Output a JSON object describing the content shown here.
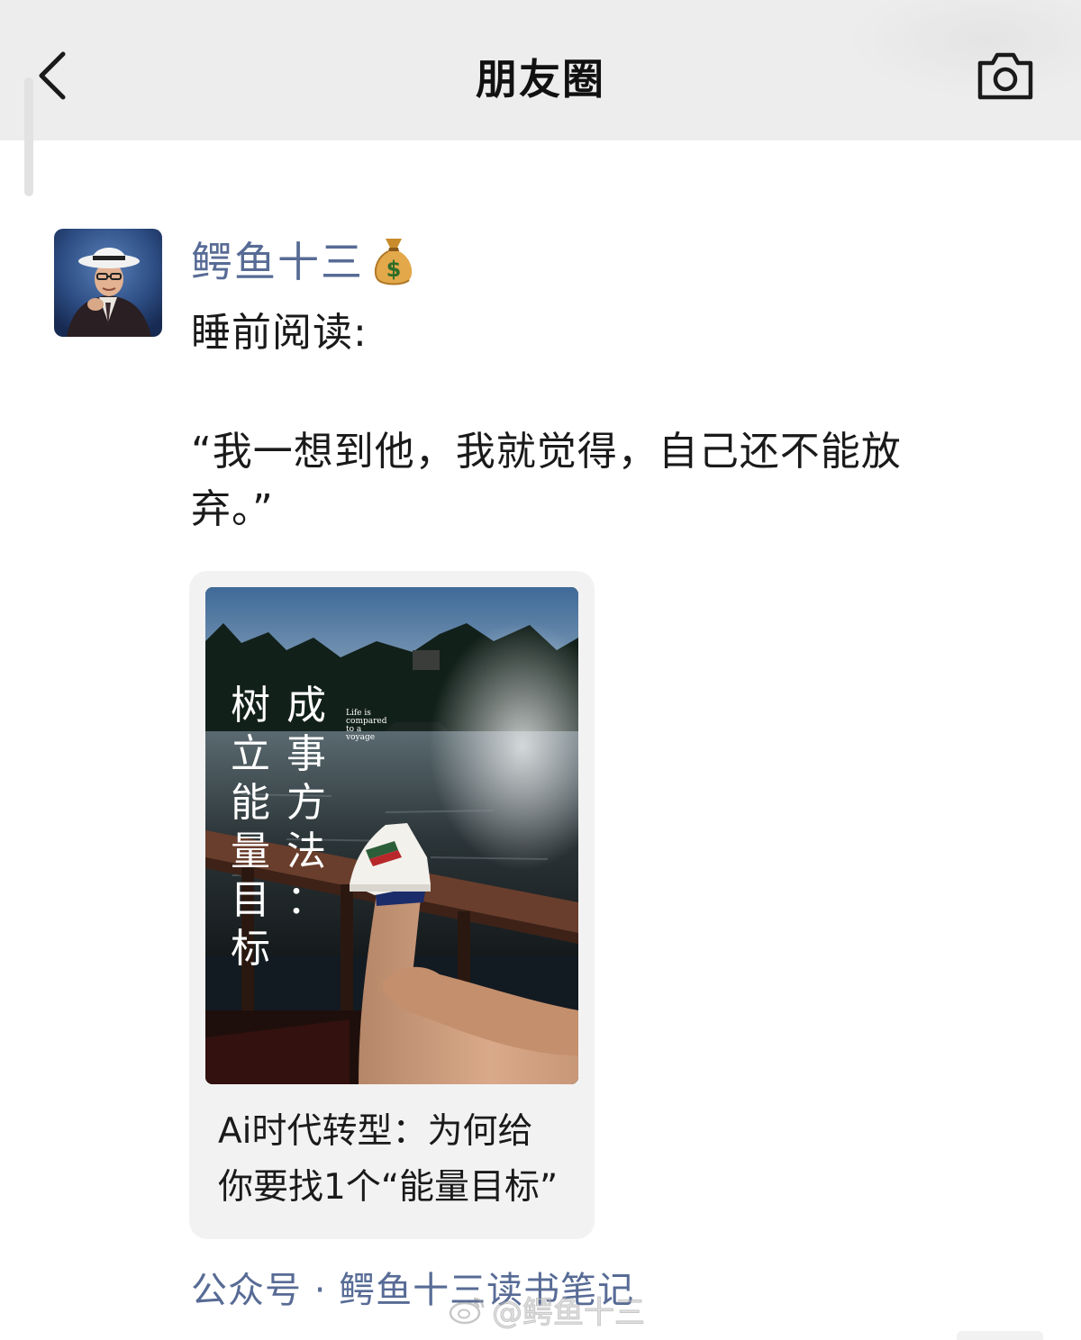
{
  "header": {
    "title": "朋友圈",
    "back_icon": "chevron-left-icon",
    "camera_icon": "camera-icon"
  },
  "post": {
    "author": "鳄鱼十三",
    "author_badge_icon": "money-bag-icon",
    "text_line1": "睡前阅读:",
    "text_line2": "“我一想到他，我就觉得，自己还不能放",
    "text_line3": "弃。”",
    "card": {
      "cover_title_right": [
        "成",
        "事",
        "方",
        "法",
        "："
      ],
      "cover_title_left": [
        "树",
        "立",
        "能",
        "量",
        "目",
        "标"
      ],
      "cover_small_lines": [
        "Life is",
        "compared",
        "to a",
        "voyage"
      ],
      "caption_line1": "Ai时代转型：为何给",
      "caption_line2": "你要找1个“能量目标”"
    },
    "source": "公众号 · 鳄鱼十三读书笔记"
  },
  "watermark": {
    "text": "@鳄鱼十三",
    "icon": "weibo-logo-icon"
  },
  "colors": {
    "header_bg": "#ededed",
    "link_blue": "#576b95",
    "card_bg": "#f2f2f2"
  }
}
